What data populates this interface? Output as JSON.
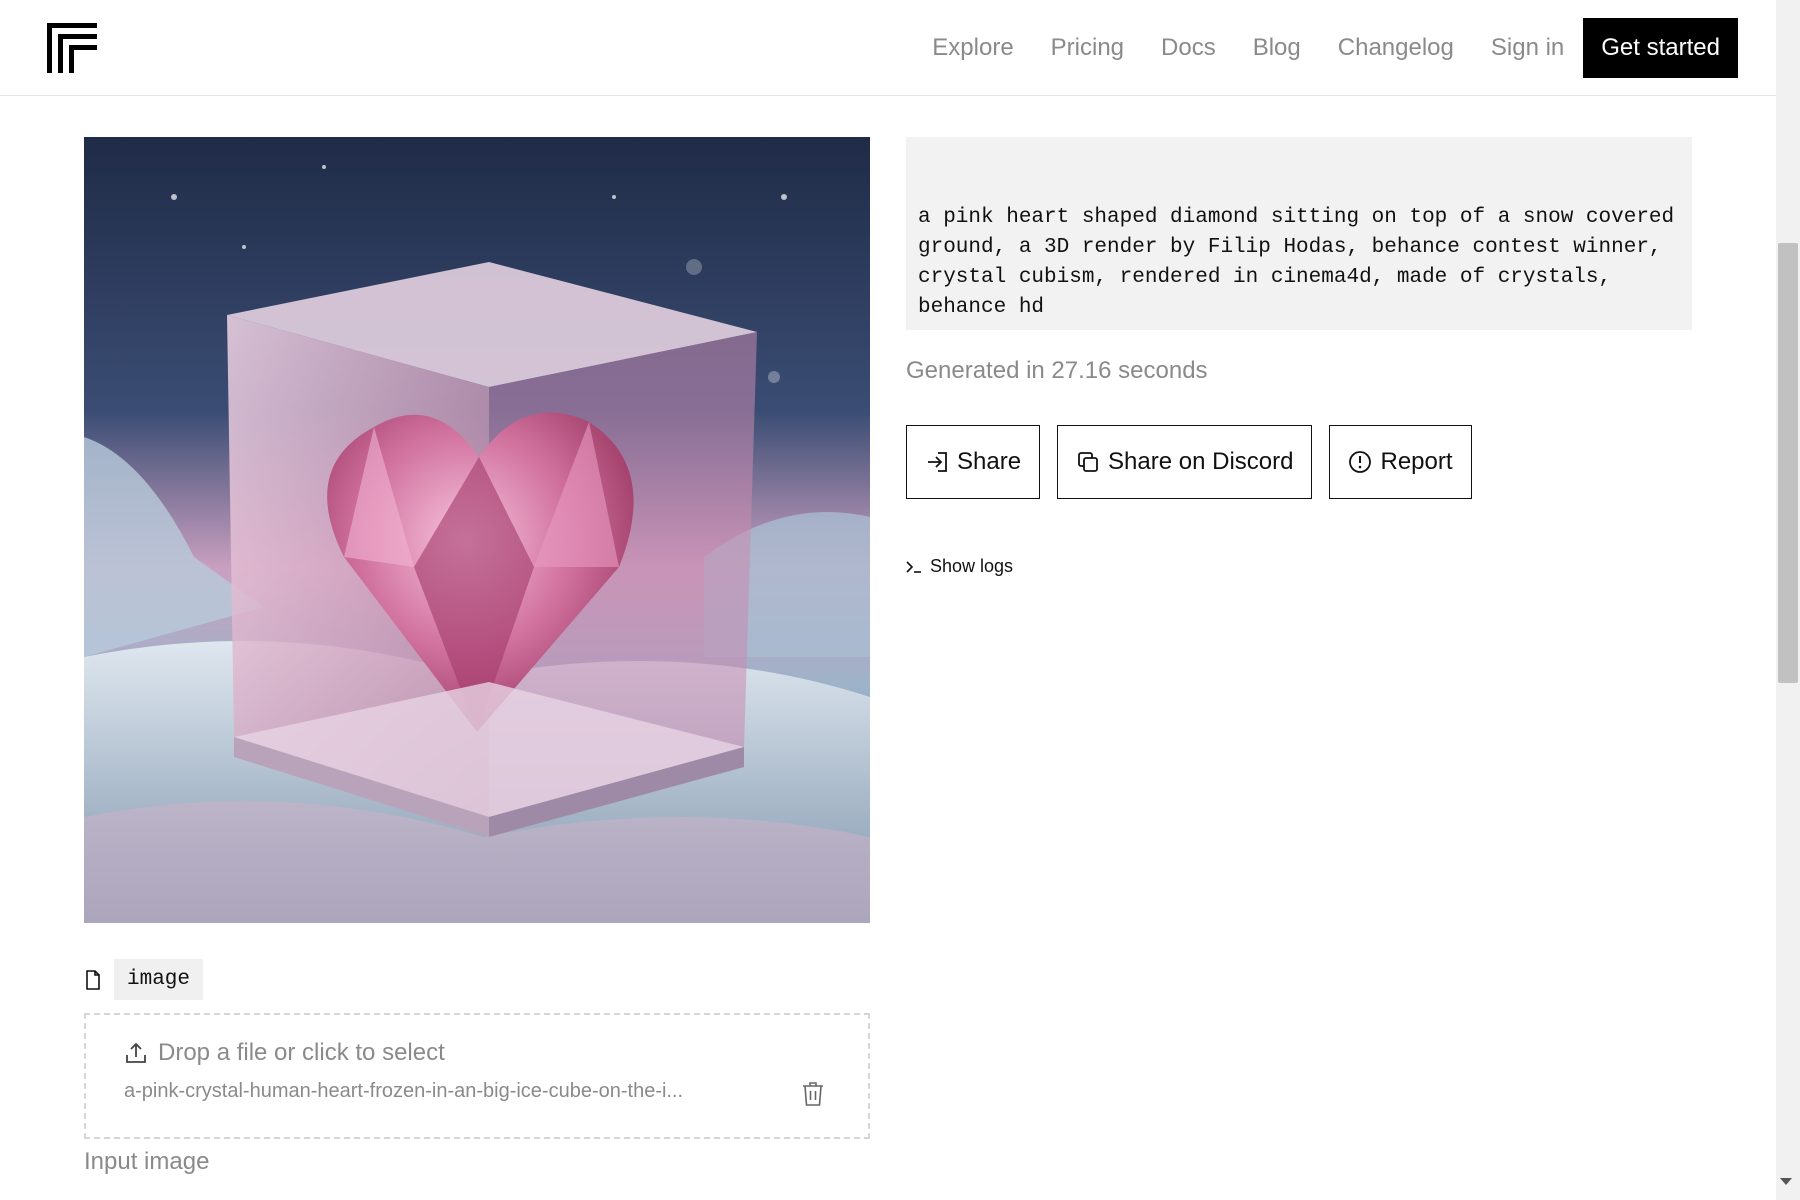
{
  "header": {
    "nav": [
      "Explore",
      "Pricing",
      "Docs",
      "Blog",
      "Changelog",
      "Sign in"
    ],
    "cta": "Get started"
  },
  "output": {
    "prompt": "a pink heart shaped diamond sitting on top of a snow covered ground, a 3D render by Filip Hodas, behance contest winner, crystal cubism, rendered in cinema4d, made of crystals, behance hd",
    "generated_text": "Generated in 27.16 seconds",
    "buttons": {
      "share": "Share",
      "discord": "Share on Discord",
      "report": "Report"
    },
    "show_logs": "Show logs"
  },
  "input": {
    "param_name": "image",
    "drop_text": "Drop a file or click to select",
    "file_name": "a-pink-crystal-human-heart-frozen-in-an-big-ice-cube-on-the-i...",
    "label": "Input image"
  },
  "icons": {
    "logo": "brand-logo",
    "share": "share-arrow-icon",
    "discord": "copy-icon",
    "report": "alert-circle-icon",
    "logs": "terminal-icon",
    "file": "file-icon",
    "upload": "upload-icon",
    "trash": "trash-icon"
  },
  "colors": {
    "cta_bg": "#000000",
    "muted_text": "#8a8a8a",
    "prompt_bg": "#f2f2f2"
  }
}
